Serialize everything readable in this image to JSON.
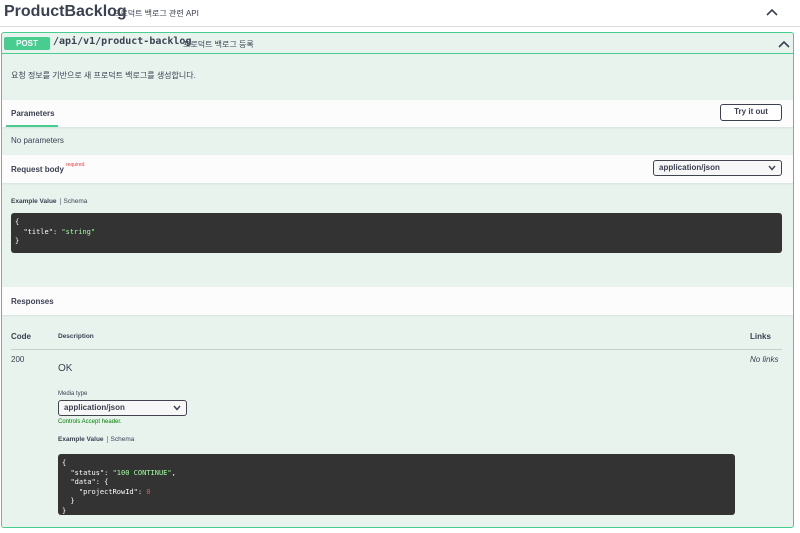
{
  "tag": {
    "title": "ProductBacklog",
    "description": "프로덕트 백로그 관련 API"
  },
  "operation": {
    "method": "POST",
    "path": "/api/v1/product-backlog",
    "summary": "프로덕트 백로그 등록",
    "description": "요청 정보를 기반으로 새 프로덕트 백로그를 생성합니다."
  },
  "parameters": {
    "tab_label": "Parameters",
    "try_it_out": "Try it out",
    "empty_text": "No parameters"
  },
  "request_body": {
    "label": "Request body",
    "required": "required",
    "content_type": "application/json",
    "tabs": [
      "Example Value",
      "Schema"
    ],
    "example": {
      "open": "{",
      "key": "\"title\"",
      "value": "\"string\"",
      "close": "}"
    }
  },
  "responses": {
    "title": "Responses",
    "headers": {
      "code": "Code",
      "description": "Description",
      "links": "Links"
    },
    "rows": [
      {
        "code": "200",
        "description": "OK",
        "links": "No links",
        "media_type_label": "Media type",
        "media_type": "application/json",
        "controls_text": "Controls Accept header.",
        "tabs": [
          "Example Value",
          "Schema"
        ],
        "example": {
          "status_key": "\"status\"",
          "status_value": "\"100 CONTINUE\"",
          "data_key": "\"data\"",
          "project_key": "\"projectRowId\"",
          "project_value": "0"
        }
      }
    ]
  },
  "colors": {
    "post": "#49cc90",
    "post_bg": "#e8f3ee",
    "code_bg": "#333333",
    "string": "#a2fca2",
    "number": "#d36363",
    "required": "#f93e3e"
  }
}
